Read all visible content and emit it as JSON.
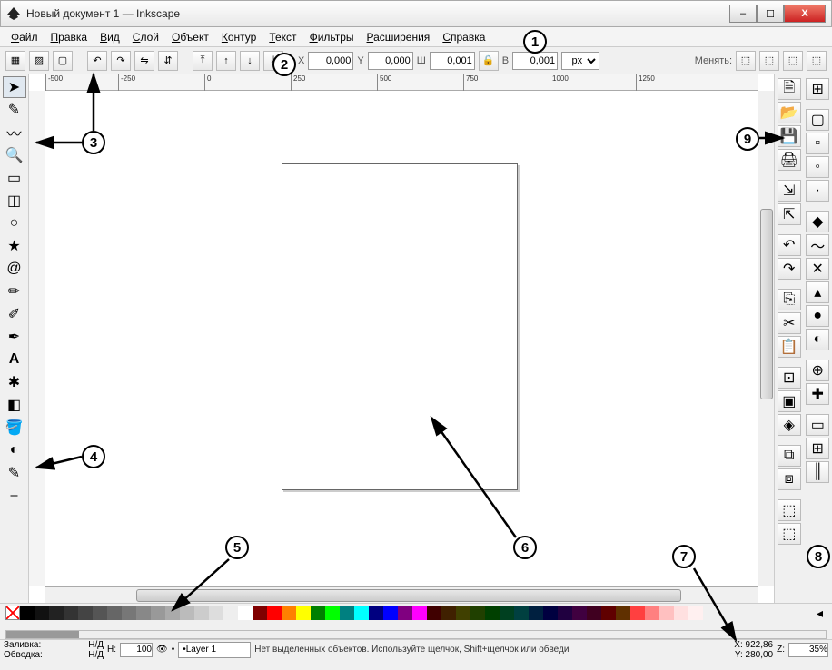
{
  "titlebar": {
    "title": "Новый документ 1 — Inkscape",
    "min_icon": "–",
    "max_icon": "☐",
    "close_icon": "X"
  },
  "menu": {
    "items": [
      {
        "u": "Ф",
        "rest": "айл"
      },
      {
        "u": "П",
        "rest": "равка"
      },
      {
        "u": "В",
        "rest": "ид"
      },
      {
        "u": "С",
        "rest": "лой"
      },
      {
        "u": "О",
        "rest": "бъект"
      },
      {
        "u": "К",
        "rest": "онтур"
      },
      {
        "u": "Т",
        "rest": "екст"
      },
      {
        "u": "Ф",
        "rest": "ильтры"
      },
      {
        "u": "Р",
        "rest": "асширения"
      },
      {
        "u": "С",
        "rest": "правка"
      }
    ]
  },
  "toolopts": {
    "x_label": "X",
    "x": "0,000",
    "y_label": "Y",
    "y": "0,000",
    "w_label": "Ш",
    "w": "0,001",
    "h_label": "В",
    "h": "0,001",
    "units": "px",
    "change_label": "Менять:"
  },
  "ruler_labels": [
    "-500",
    "-250",
    "0",
    "250",
    "500",
    "750",
    "1000",
    "1250"
  ],
  "palette_grays": [
    "#000",
    "#111",
    "#222",
    "#333",
    "#444",
    "#555",
    "#666",
    "#777",
    "#888",
    "#999",
    "#aaa",
    "#bbb",
    "#ccc",
    "#ddd",
    "#eee",
    "#fff"
  ],
  "palette_colors": [
    "#800000",
    "#ff0000",
    "#ff8000",
    "#ffff00",
    "#008000",
    "#00ff00",
    "#008080",
    "#00ffff",
    "#000080",
    "#0000ff",
    "#800080",
    "#ff00ff",
    "#400000",
    "#402000",
    "#404000",
    "#204000",
    "#004000",
    "#004020",
    "#004040",
    "#002040",
    "#000040",
    "#200040",
    "#400040",
    "#400020",
    "#600000",
    "#603000",
    "#ff4040",
    "#ff8080",
    "#ffc0c0",
    "#ffe0e0",
    "#fff0f0"
  ],
  "status": {
    "fill_label": "Заливка:",
    "fill_value": "Н/Д",
    "stroke_label": "Обводка:",
    "stroke_value": "Н/Д",
    "opacity_label": "Н:",
    "opacity": "100",
    "layer_label": "Layer 1",
    "hint": "Нет выделенных объектов. Используйте щелчок, Shift+щелчок или обведи",
    "x_label": "X:",
    "x": "922,86",
    "y_label": "Y:",
    "y": "280,00",
    "z_label": "Z:",
    "z": "35%"
  },
  "annotations": [
    "1",
    "2",
    "3",
    "4",
    "5",
    "6",
    "7",
    "8",
    "9"
  ]
}
